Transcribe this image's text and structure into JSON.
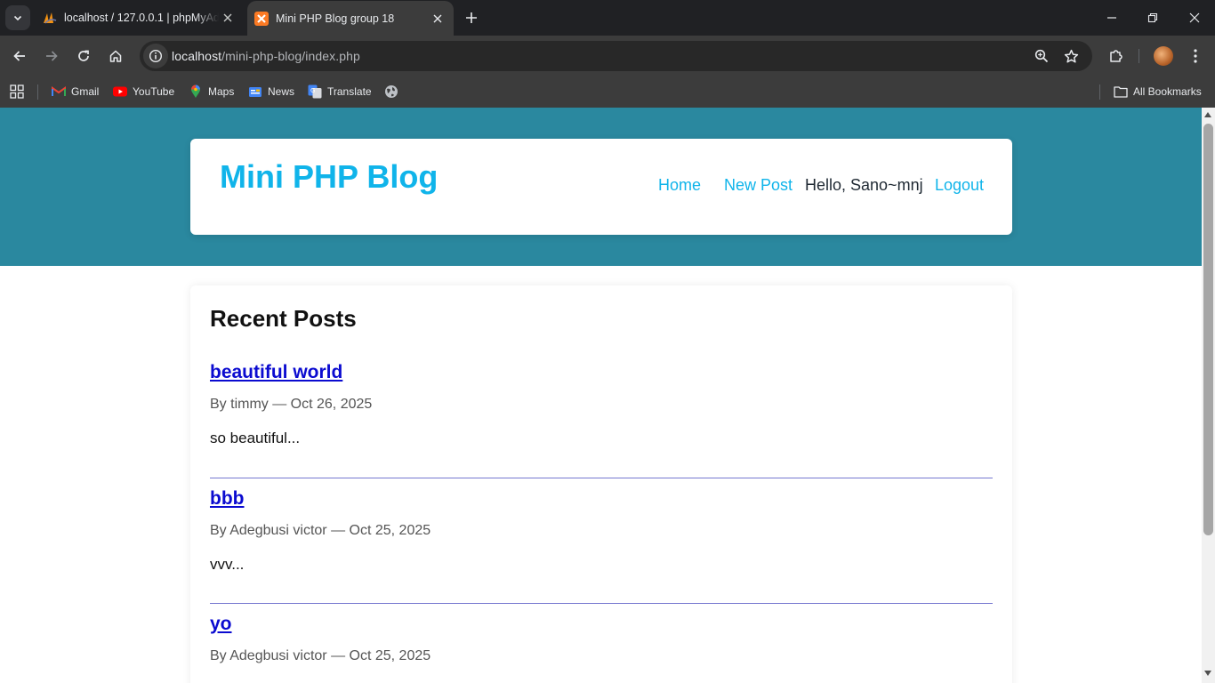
{
  "browser": {
    "tabs": [
      {
        "title": "localhost / 127.0.0.1 | phpMyAdmin",
        "favicon": "phpmyadmin-icon",
        "active": false
      },
      {
        "title": "Mini PHP Blog group 18",
        "favicon": "xampp-icon",
        "active": true
      }
    ],
    "url_host": "localhost",
    "url_path": "/mini-php-blog/index.php",
    "bookmarks": [
      {
        "label": "Gmail",
        "icon": "gmail-icon"
      },
      {
        "label": "YouTube",
        "icon": "youtube-icon"
      },
      {
        "label": "Maps",
        "icon": "maps-icon"
      },
      {
        "label": "News",
        "icon": "news-icon"
      },
      {
        "label": "Translate",
        "icon": "translate-icon"
      }
    ],
    "all_bookmarks_label": "All Bookmarks"
  },
  "site": {
    "logo": "Mini PHP Blog",
    "nav": {
      "home": "Home",
      "new_post": "New Post",
      "greeting": "Hello, Sano~mnj",
      "logout": "Logout"
    },
    "brand_color": "#10b4ea",
    "hero_color": "#2a889f"
  },
  "recent": {
    "heading": "Recent Posts",
    "posts": [
      {
        "title": "beautiful world",
        "meta": "By timmy — Oct 26, 2025",
        "excerpt": "so beautiful..."
      },
      {
        "title": "bbb",
        "meta": "By Adegbusi victor — Oct 25, 2025",
        "excerpt": "vvv..."
      },
      {
        "title": "yo",
        "meta": "By Adegbusi victor — Oct 25, 2025",
        "excerpt": ""
      }
    ]
  }
}
